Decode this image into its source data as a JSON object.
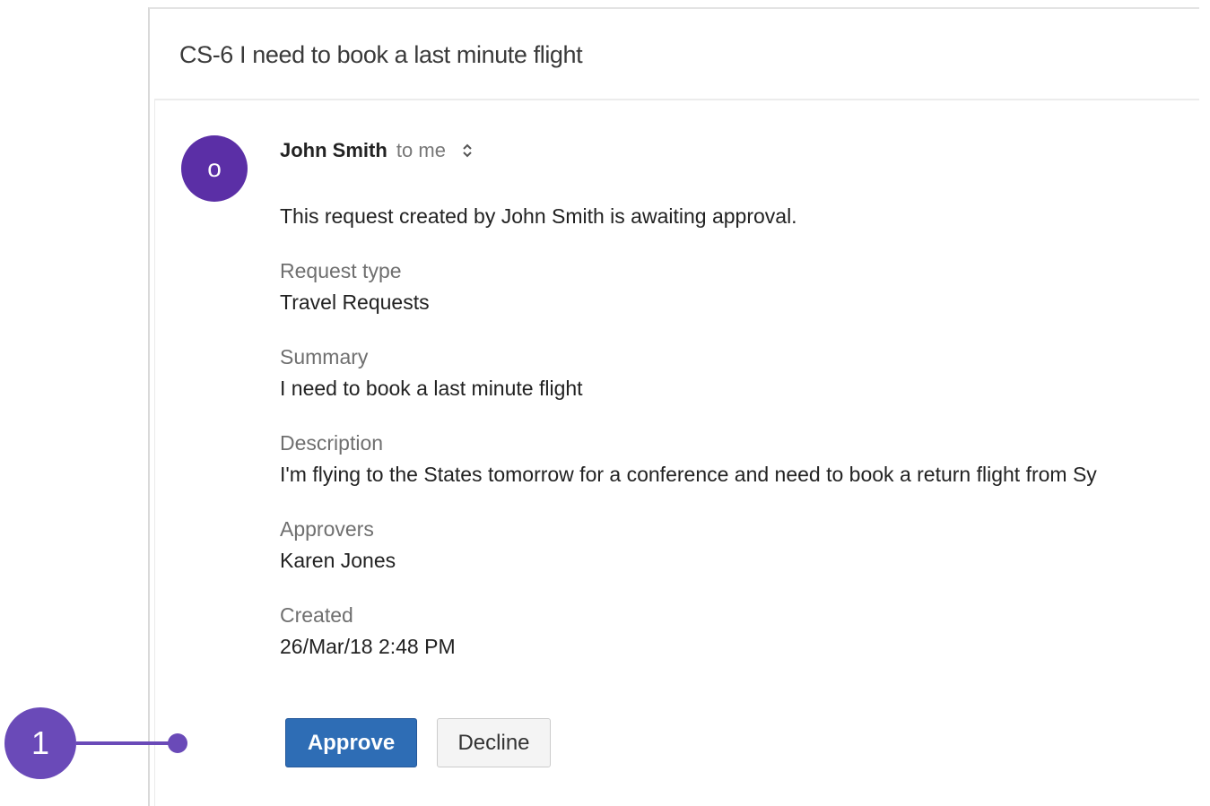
{
  "email": {
    "subject": "CS-6 I need to book a last minute flight",
    "avatar_initial": "o",
    "avatar_color": "#5b2fa6",
    "sender_name": "John Smith",
    "recipient": "to me",
    "intro": "This request created by John Smith is awaiting approval.",
    "fields": [
      {
        "label": "Request type",
        "value": "Travel Requests"
      },
      {
        "label": "Summary",
        "value": "I need to book a last minute flight"
      },
      {
        "label": "Description",
        "value": "I'm flying to the States tomorrow for a conference and need to book a return flight from Sy"
      },
      {
        "label": "Approvers",
        "value": "Karen Jones"
      },
      {
        "label": "Created",
        "value": "26/Mar/18 2:48 PM"
      }
    ]
  },
  "actions": {
    "approve_label": "Approve",
    "decline_label": "Decline",
    "approve_color": "#2e6db5"
  },
  "callout": {
    "number": "1",
    "color": "#6a4ab8"
  }
}
